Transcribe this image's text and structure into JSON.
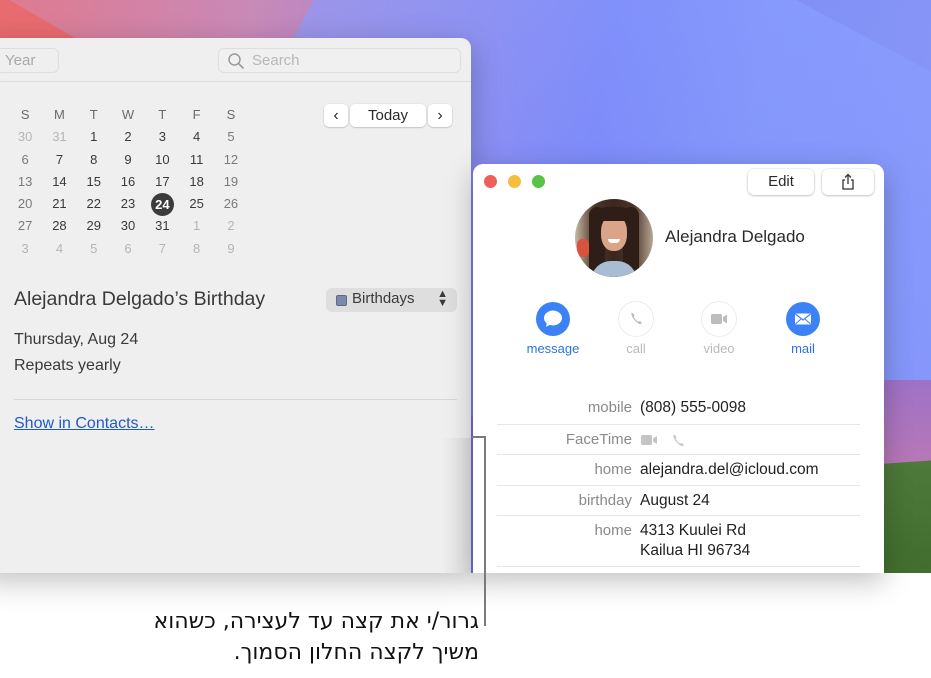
{
  "calendar_window": {
    "view_segment_label": "Year",
    "search": {
      "placeholder": "Search",
      "icon": "search-icon"
    },
    "weekday_headers": [
      "S",
      "M",
      "T",
      "W",
      "T",
      "F",
      "S"
    ],
    "weeks": [
      [
        {
          "d": "30",
          "dim": true
        },
        {
          "d": "31",
          "dim": true
        },
        {
          "d": "1"
        },
        {
          "d": "2"
        },
        {
          "d": "3"
        },
        {
          "d": "4"
        },
        {
          "d": "5",
          "wk": true
        }
      ],
      [
        {
          "d": "6",
          "wk": true
        },
        {
          "d": "7"
        },
        {
          "d": "8"
        },
        {
          "d": "9"
        },
        {
          "d": "10"
        },
        {
          "d": "11"
        },
        {
          "d": "12",
          "wk": true
        }
      ],
      [
        {
          "d": "13",
          "wk": true
        },
        {
          "d": "14"
        },
        {
          "d": "15"
        },
        {
          "d": "16"
        },
        {
          "d": "17"
        },
        {
          "d": "18"
        },
        {
          "d": "19",
          "wk": true
        }
      ],
      [
        {
          "d": "20",
          "wk": true
        },
        {
          "d": "21"
        },
        {
          "d": "22"
        },
        {
          "d": "23"
        },
        {
          "d": "24",
          "today": true
        },
        {
          "d": "25"
        },
        {
          "d": "26",
          "wk": true
        }
      ],
      [
        {
          "d": "27",
          "wk": true
        },
        {
          "d": "28"
        },
        {
          "d": "29"
        },
        {
          "d": "30"
        },
        {
          "d": "31"
        },
        {
          "d": "1",
          "dim": true
        },
        {
          "d": "2",
          "dim": true
        }
      ],
      [
        {
          "d": "3",
          "dim": true
        },
        {
          "d": "4",
          "dim": true
        },
        {
          "d": "5",
          "dim": true
        },
        {
          "d": "6",
          "dim": true
        },
        {
          "d": "7",
          "dim": true
        },
        {
          "d": "8",
          "dim": true
        },
        {
          "d": "9",
          "dim": true
        }
      ]
    ],
    "nav": {
      "prev_icon": "chevron-left-icon",
      "prev_glyph": "‹",
      "today_label": "Today",
      "next_icon": "chevron-right-icon",
      "next_glyph": "›"
    },
    "event": {
      "title": "Alejandra Delgado’s Birthday",
      "calendar_select": {
        "selected": "Birthdays",
        "color": "#7b8aa8",
        "arrows_glyph": "⌃⌄"
      },
      "date": "Thursday, Aug 24",
      "repeat": "Repeats yearly",
      "link": "Show in Contacts…"
    }
  },
  "contact_window": {
    "toolbar": {
      "edit_label": "Edit",
      "share_icon": "share-icon"
    },
    "name": "Alejandra Delgado",
    "actions": [
      {
        "label": "message",
        "icon": "message-icon",
        "enabled": true
      },
      {
        "label": "call",
        "icon": "phone-icon",
        "enabled": false
      },
      {
        "label": "video",
        "icon": "video-icon",
        "enabled": false
      },
      {
        "label": "mail",
        "icon": "mail-icon",
        "enabled": true
      }
    ],
    "details": [
      {
        "label": "mobile",
        "value": "(808) 555-0098"
      },
      {
        "label": "FaceTime",
        "value": ""
      },
      {
        "label": "home",
        "value": "alejandra.del@icloud.com"
      },
      {
        "label": "birthday",
        "value": "August 24"
      },
      {
        "label": "home",
        "value_lines": [
          "4313 Kuulei Rd",
          "Kailua HI 96734"
        ]
      }
    ],
    "colors": {
      "accent": "#3a82f6",
      "disabled": "#b9b9b9"
    }
  },
  "caption": {
    "lines": [
      "גרור/י את קצה עד לעצירה, כשהוא",
      "משיך לקצה החלון הסמוך."
    ]
  }
}
